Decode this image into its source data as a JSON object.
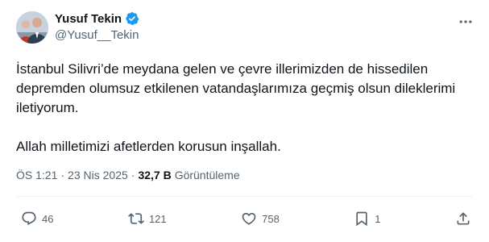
{
  "author": {
    "display_name": "Yusuf Tekin",
    "handle": "@Yusuf__Tekin",
    "verified": true,
    "verified_color": "#1d9bf0"
  },
  "post": {
    "paragraph_1": "İstanbul Silivri’de meydana gelen ve çevre illerimizden de hissedilen depremden olumsuz etkilenen vatandaşlarımıza geçmiş olsun dileklerimi iletiyorum.",
    "paragraph_2": "Allah milletimizi afetlerden korusun inşallah."
  },
  "meta": {
    "time": "ÖS 1:21",
    "separator": "·",
    "date": "23 Nis 2025",
    "views_count": "32,7 B",
    "views_label": "Görüntüleme"
  },
  "actions": {
    "replies": "46",
    "reposts": "121",
    "likes": "758",
    "bookmarks": "1"
  },
  "icons": [
    "verified-badge-icon",
    "more-icon",
    "reply-icon",
    "repost-icon",
    "like-icon",
    "bookmark-icon",
    "share-icon"
  ],
  "colors": {
    "text": "#0f1419",
    "secondary": "#536471",
    "divider": "#eff3f4"
  }
}
